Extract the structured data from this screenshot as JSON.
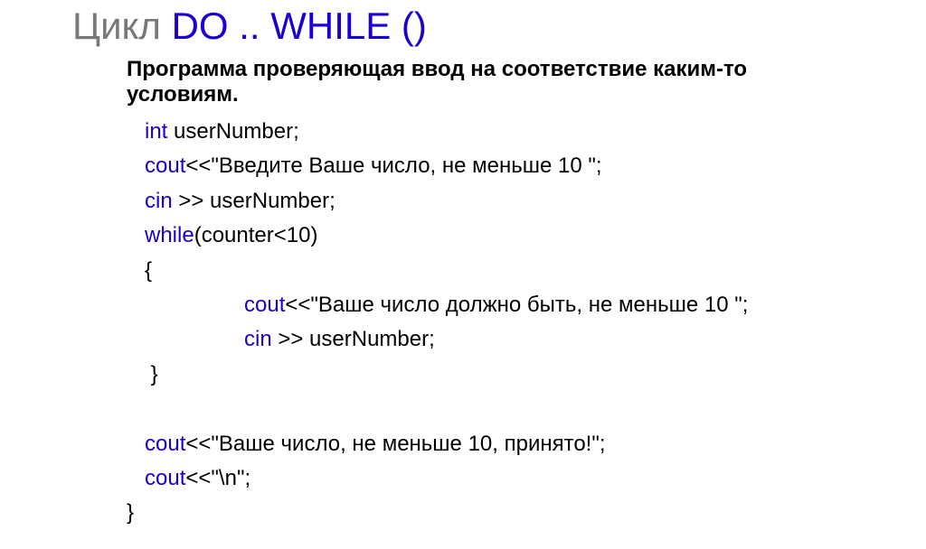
{
  "title": {
    "part1": "Цикл ",
    "part2": "DO ..  WHILE ()"
  },
  "subtitle": "Программа проверяющая ввод на соответствие каким-то условиям.",
  "code": {
    "line1_kw": "int ",
    "line1_rest": "userNumber;",
    "line2_kw": "cout",
    "line2_rest": "<<\"Введите Ваше число, не меньше 10 \";",
    "line3_kw": "cin ",
    "line3_rest": ">> userNumber;",
    "line4_kw": "while",
    "line4_rest": "(counter<10)",
    "line5": "{",
    "line6_kw": "cout",
    "line6_rest": "<<\"Ваше число должно быть, не меньше 10 \";",
    "line7_kw": "cin ",
    "line7_rest": ">> userNumber;",
    "line8": " }",
    "line9_blank": " ",
    "line10_kw": "cout",
    "line10_rest": "<<\"Ваше число, не меньше 10, принято!\";",
    "line11_kw": "cout",
    "line11_rest": "<<\"\\n\";",
    "line12": "}"
  }
}
